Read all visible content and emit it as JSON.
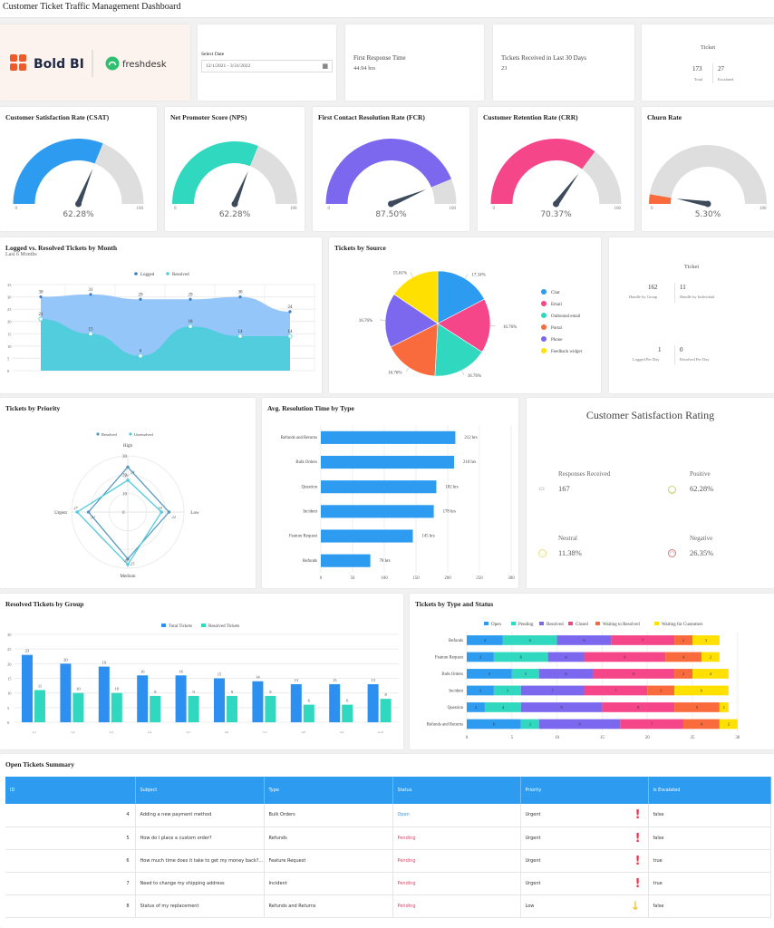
{
  "header": {
    "title": "Customer Ticket Traffic Management Dashboard"
  },
  "logos": {
    "boldbi": "Bold BI",
    "freshdesk": "freshdesk"
  },
  "date_filter": {
    "label": "Select Date",
    "value": "12/1/2021 - 3/31/2022",
    "icon": "calendar-icon"
  },
  "kpis": [
    {
      "label": "First Response Time",
      "value": "44.94 hrs"
    },
    {
      "label": "Tickets Received in Last 30 Days",
      "value": "23"
    }
  ],
  "ticket_summary": {
    "title": "Ticket",
    "total": "173",
    "total_label": "Total",
    "escalated": "27",
    "escalated_label": "Escalated"
  },
  "gauges": [
    {
      "title": "Customer Satisfaction Rate (CSAT)",
      "value": 62.28,
      "display": "62.28%",
      "min": "0",
      "max": "100",
      "color": "#2d9bf0"
    },
    {
      "title": "Net Promoter Score (NPS)",
      "value": 62.28,
      "display": "62.28%",
      "min": "0",
      "max": "100",
      "color": "#2fd8be"
    },
    {
      "title": "First Contact Resolution Rate (FCR)",
      "value": 87.5,
      "display": "87.50%",
      "min": "0",
      "max": "100",
      "color": "#7b68ee"
    },
    {
      "title": "Customer Retention Rate (CRR)",
      "value": 70.37,
      "display": "70.37%",
      "min": "0",
      "max": "100",
      "color": "#f5468a"
    },
    {
      "title": "Churn Rate",
      "value": 5.3,
      "display": "5.30%",
      "min": "0",
      "max": "100",
      "color": "#f96a3c"
    }
  ],
  "logged_resolved": {
    "title": "Logged vs. Resolved Tickets by Month",
    "subtitle": "Last 6 Months",
    "chart_data": {
      "type": "area",
      "series": [
        {
          "name": "Logged",
          "values": [
            30,
            31,
            29,
            29,
            30,
            24
          ],
          "color": "#8fc3fa"
        },
        {
          "name": "Resolved",
          "values": [
            21,
            15,
            6,
            18,
            14,
            14
          ],
          "color": "#52cddd"
        }
      ],
      "y_ticks": [
        "0",
        "5",
        "10",
        "15",
        "20",
        "25",
        "30",
        "35"
      ],
      "ylim": [
        0,
        35
      ],
      "legend": "top-center"
    }
  },
  "tickets_by_source": {
    "title": "Tickets by Source",
    "chart_data": {
      "type": "pie",
      "slices": [
        {
          "label": "Chat",
          "value": 17.34,
          "display": "17.34%",
          "color": "#2d9bf0"
        },
        {
          "label": "Email",
          "value": 16.76,
          "display": "16.76%",
          "color": "#f5468a"
        },
        {
          "label": "Outbound email",
          "value": 16.76,
          "display": "16.76%",
          "color": "#2fd8be"
        },
        {
          "label": "Portal",
          "value": 16.76,
          "display": "16.76%",
          "color": "#f96a3c"
        },
        {
          "label": "Phone",
          "value": 16.76,
          "display": "16.76%",
          "color": "#7b68ee"
        },
        {
          "label": "Feedback widget",
          "value": 15.61,
          "display": "15.61%",
          "color": "#ffe000"
        }
      ],
      "legend": "right"
    }
  },
  "ticket_handle": {
    "title": "Ticket",
    "items": [
      {
        "value": "162",
        "label": "Handle by Group"
      },
      {
        "value": "11",
        "label": "Handle by Individual"
      },
      {
        "value": "1",
        "label": "Logged Per Day"
      },
      {
        "value": "0",
        "label": "Resolved Per Day"
      }
    ]
  },
  "tickets_by_priority": {
    "title": "Tickets by Priority",
    "chart_data": {
      "type": "radar",
      "axes": [
        "High",
        "Low",
        "Medium",
        "Urgent"
      ],
      "series": [
        {
          "name": "Resolved",
          "values": [
            24,
            22,
            25,
            21
          ],
          "color": "#5b9bc2"
        },
        {
          "name": "Unresolved",
          "values": [
            17,
            18,
            28,
            27
          ],
          "color": "#52cddd"
        }
      ],
      "r_ticks": [
        "0",
        "10",
        "20",
        "30"
      ],
      "rlim": [
        0,
        30
      ]
    }
  },
  "avg_resolution": {
    "title": "Avg. Resolution Time by Type",
    "chart_data": {
      "type": "bar",
      "orientation": "horizontal",
      "categories": [
        "Refunds and Returns",
        "Bulk Orders",
        "Question",
        "Incident",
        "Feature Request",
        "Refunds"
      ],
      "values": [
        212,
        210,
        182,
        178,
        145,
        78
      ],
      "labels": [
        "212 hrs",
        "210 hrs",
        "182 hrs",
        "178 hrs",
        "145 hrs",
        "78 hrs"
      ],
      "x_ticks": [
        "0",
        "50",
        "100",
        "150",
        "200",
        "250",
        "300"
      ],
      "xlim": [
        0,
        300
      ],
      "color": "#2d9bf0"
    }
  },
  "csat_rating": {
    "title": "Customer Satisfaction Rating",
    "items": [
      {
        "label": "Responses Received",
        "value": "167",
        "icon": "chat-icon"
      },
      {
        "label": "Positive",
        "value": "62.28%",
        "icon": "smile-icon"
      },
      {
        "label": "Neutral",
        "value": "11.38%",
        "icon": "neutral-face-icon"
      },
      {
        "label": "Negative",
        "value": "26.35%",
        "icon": "sad-face-icon"
      }
    ]
  },
  "resolved_by_group": {
    "title": "Resolved Tickets by Group",
    "chart_data": {
      "type": "bar",
      "categories": [
        "G1",
        "G2",
        "G3",
        "G4",
        "G5",
        "G6",
        "G7",
        "G8",
        "G9",
        "G10"
      ],
      "series": [
        {
          "name": "Total Tickets",
          "values": [
            23,
            20,
            19,
            16,
            16,
            15,
            14,
            13,
            13,
            13
          ],
          "color": "#2d8ff0"
        },
        {
          "name": "Resolved Tickets",
          "values": [
            11,
            10,
            10,
            9,
            9,
            9,
            9,
            6,
            6,
            8
          ],
          "color": "#2fd8be"
        }
      ],
      "y_ticks": [
        "0",
        "5",
        "10",
        "15",
        "20",
        "25",
        "30"
      ],
      "ylim": [
        0,
        30
      ],
      "legend": "top-center"
    }
  },
  "type_status": {
    "title": "Tickets by Type and Status",
    "chart_data": {
      "type": "bar",
      "stacked": true,
      "orientation": "horizontal",
      "categories": [
        "Refunds",
        "Feature Request",
        "Bulk Orders",
        "Incident",
        "Question",
        "Refunds and Returns"
      ],
      "series": [
        {
          "name": "Open",
          "values": [
            4,
            3,
            5,
            3,
            2,
            6
          ],
          "color": "#2d9bf0"
        },
        {
          "name": "Pending",
          "values": [
            6,
            6,
            3,
            3,
            4,
            2
          ],
          "color": "#2fd8be"
        },
        {
          "name": "Resolved",
          "values": [
            6,
            4,
            6,
            7,
            9,
            9
          ],
          "color": "#7b68ee"
        },
        {
          "name": "Closed",
          "values": [
            7,
            9,
            9,
            7,
            8,
            7
          ],
          "color": "#f5468a"
        },
        {
          "name": "Waiting to Resolved",
          "values": [
            2,
            4,
            2,
            3,
            5,
            4
          ],
          "color": "#f96a3c"
        },
        {
          "name": "Waiting for Customers",
          "values": [
            3,
            2,
            4,
            6,
            1,
            2
          ],
          "color": "#ffe000"
        }
      ],
      "x_ticks": [
        "0",
        "5",
        "10",
        "15",
        "20",
        "25",
        "30"
      ],
      "xlim": [
        0,
        30
      ],
      "legend": "top-center"
    }
  },
  "open_tickets": {
    "title": "Open Tickets Summary",
    "columns": [
      "ID",
      "Subject",
      "Type",
      "Status",
      "Priority",
      "Is Escalated"
    ],
    "rows": [
      {
        "id": "4",
        "subject": "Adding a new payment method",
        "type": "Bulk Orders",
        "status": "Open",
        "priority": "Urgent",
        "escalated": "false"
      },
      {
        "id": "5",
        "subject": "How do I place a custom order?",
        "type": "Refunds",
        "status": "Pending",
        "priority": "Urgent",
        "escalated": "false"
      },
      {
        "id": "6",
        "subject": "How much time does it take to get my money back?...",
        "type": "Feature Request",
        "status": "Pending",
        "priority": "Urgent",
        "escalated": "true"
      },
      {
        "id": "7",
        "subject": "Need to change my shipping address",
        "type": "Incident",
        "status": "Pending",
        "priority": "Urgent",
        "escalated": "true"
      },
      {
        "id": "8",
        "subject": "Status of my replacement",
        "type": "Refunds and Returns",
        "status": "Pending",
        "priority": "Low",
        "escalated": "false"
      }
    ],
    "status_colors": {
      "Open": "#2d9bf0",
      "Pending": "#e0436b"
    },
    "priority_icons": {
      "Urgent": {
        "glyph": "!",
        "color": "#e53950"
      },
      "Low": {
        "glyph": "↓",
        "color": "#f5c542"
      }
    }
  }
}
